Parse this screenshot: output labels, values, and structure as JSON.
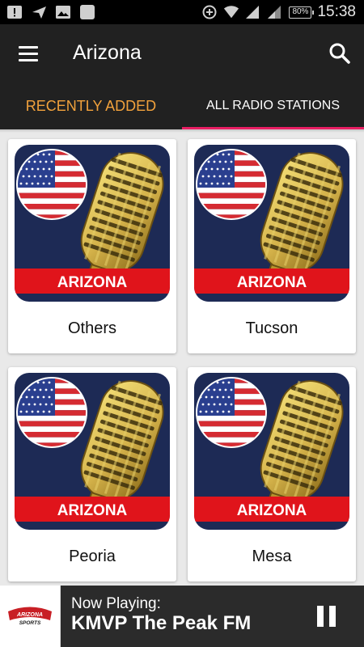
{
  "status_bar": {
    "time": "15:38",
    "battery": "80%",
    "icons": [
      "notification-icon",
      "send-icon",
      "image-icon",
      "app-icon",
      "data-saver-icon",
      "wifi-icon",
      "signal-icon",
      "battery-icon"
    ]
  },
  "toolbar": {
    "title": "Arizona",
    "menu_icon": "hamburger-menu-icon",
    "search_icon": "search-icon"
  },
  "tabs": [
    {
      "label": "RECENTLY ADDED",
      "selected": false
    },
    {
      "label": "ALL RADIO STATIONS",
      "selected": true
    }
  ],
  "colors": {
    "toolbar_bg": "#212121",
    "tab_accent": "#f2a23c",
    "tab_indicator": "#e91e63",
    "banner_red": "#e0141b",
    "mic_gold": "#d4b24a"
  },
  "stations": [
    {
      "name": "Others",
      "banner": "ARIZONA"
    },
    {
      "name": "Tucson",
      "banner": "ARIZONA"
    },
    {
      "name": "Peoria",
      "banner": "ARIZONA"
    },
    {
      "name": "Mesa",
      "banner": "ARIZONA"
    }
  ],
  "player": {
    "now_playing_label": "Now Playing:",
    "station": "KMVP The Peak FM",
    "logo_text": "ARIZONA SPORTS",
    "pause_icon": "pause-icon"
  }
}
